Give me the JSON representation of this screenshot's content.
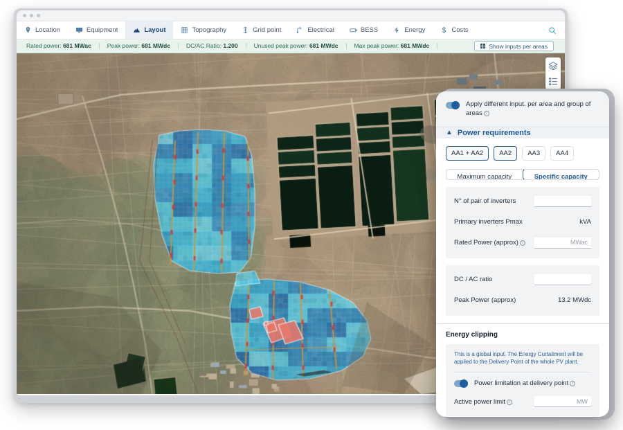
{
  "window": {
    "dots": 3
  },
  "tabs": [
    {
      "label": "Location",
      "icon": "pin-icon",
      "active": false
    },
    {
      "label": "Equipment",
      "icon": "monitor-icon",
      "active": false
    },
    {
      "label": "Layout",
      "icon": "mountain-icon",
      "active": true
    },
    {
      "label": "Topography",
      "icon": "terrain-icon",
      "active": false
    },
    {
      "label": "Grid point",
      "icon": "tower-icon",
      "active": false
    },
    {
      "label": "Electrical",
      "icon": "circuit-icon",
      "active": false
    },
    {
      "label": "BESS",
      "icon": "battery-icon",
      "active": false
    },
    {
      "label": "Energy",
      "icon": "bolt-icon",
      "active": false
    },
    {
      "label": "Costs",
      "icon": "dollar-icon",
      "active": false
    }
  ],
  "search": {
    "icon": "search-icon"
  },
  "stats": [
    {
      "label": "Rated power:",
      "value": "681 MWac"
    },
    {
      "label": "Peak power:",
      "value": "681 MWdc"
    },
    {
      "label": "DC/AC Ratio:",
      "value": "1.200"
    },
    {
      "label": "Unused peak power:",
      "value": "681 MWdc"
    },
    {
      "label": "Max peak power:",
      "value": "681 MWdc"
    }
  ],
  "show_inputs_button": {
    "label": "Show inputs per areas",
    "icon": "grid-icon"
  },
  "map_controls": [
    {
      "name": "layers-icon"
    },
    {
      "name": "legend-list-icon"
    }
  ],
  "panel": {
    "apply_toggle": {
      "label": "Apply different input. per area and group of areas",
      "state": "on",
      "info_icon": "info-icon"
    },
    "power_requirements": {
      "title": "Power requirements",
      "chevron": "chevron-up-icon",
      "areas": [
        {
          "label": "AA1 + AA2",
          "selected": true
        },
        {
          "label": "AA2",
          "selected": true
        },
        {
          "label": "AA3",
          "selected": false
        },
        {
          "label": "AA4",
          "selected": false
        }
      ],
      "capacity_tabs": [
        {
          "label": "Maximum capacity",
          "active": false
        },
        {
          "label": "Specific capacity",
          "active": true
        }
      ],
      "fields": [
        {
          "label": "N° of pair of inverters",
          "kind": "input",
          "value": "",
          "info": false
        },
        {
          "label": "Primary inverters Pmax",
          "kind": "text",
          "value": "kVA",
          "info": false
        },
        {
          "label": "Rated Power (approx)",
          "kind": "input",
          "value": "MWac",
          "info": true
        }
      ],
      "fields2": [
        {
          "label": "DC / AC ratio",
          "kind": "input",
          "value": "",
          "info": false
        },
        {
          "label": "Peak Power (approx)",
          "kind": "text",
          "value": "13.2 MWdc",
          "info": false
        }
      ]
    },
    "energy_clipping": {
      "title": "Energy clipping",
      "note": "This is a global input. The Energy Curtailment will be applied to the Delivery Point of the whole PV plant.",
      "power_limitation": {
        "label": "Power limitation at delivery point",
        "state": "on",
        "info_icon": "info-icon"
      },
      "active_power_limit": {
        "label": "Active power limit",
        "value": "MW",
        "info_icon": "info-icon"
      }
    }
  },
  "colors": {
    "accent_blue": "#1e5b96",
    "stats_bg": "#e8f3ec",
    "stats_text": "#2e6b55",
    "panel_bg": "#f2f3f5",
    "array_cyan": "#35b4dd",
    "array_blue": "#2f7fc0",
    "exclusion_red": "#e8776a"
  }
}
